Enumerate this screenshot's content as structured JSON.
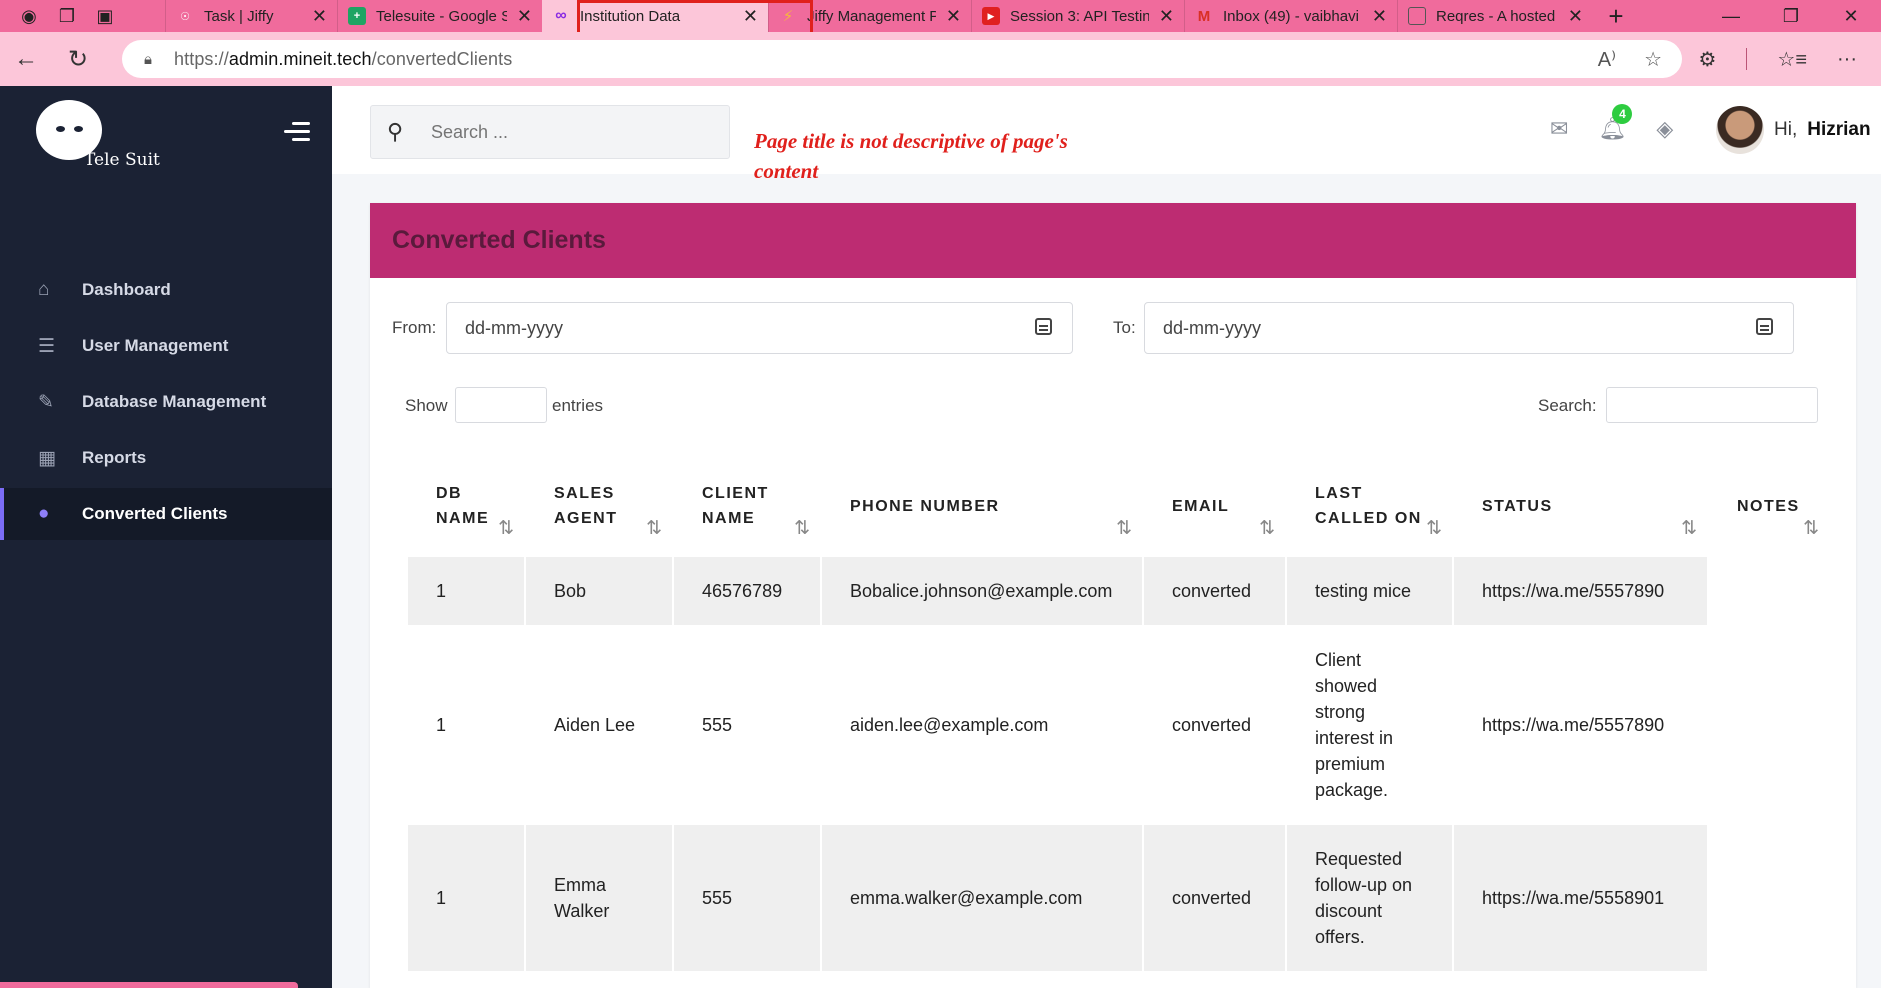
{
  "browser": {
    "tabs": [
      {
        "title": "Task | Jiffy",
        "favicon_color": "#f06b9c",
        "favicon": "finger-print-icon"
      },
      {
        "title": "Telesuite - Google Sh",
        "favicon_color": "#1fa463",
        "favicon": "sheets-icon"
      },
      {
        "title": "Institution Data",
        "favicon_color": "#8a2be2",
        "favicon": "infinity-icon",
        "active": true
      },
      {
        "title": "Jiffy Management Pa",
        "favicon_color": "#f6b83b",
        "favicon": "bolt-icon"
      },
      {
        "title": "Session 3: API Testin",
        "favicon_color": "#e02020",
        "favicon": "youtube-icon"
      },
      {
        "title": "Inbox (49) - vaibhavi",
        "favicon_color": "#d93025",
        "favicon": "gmail-icon"
      },
      {
        "title": "Reqres - A hosted RE",
        "favicon_color": "#555555",
        "favicon": "page-icon"
      }
    ],
    "url_prefix": "https://",
    "url_host": "admin.mineit.tech",
    "url_path": "/convertedClients"
  },
  "sidebar": {
    "brand": "Tele Suit",
    "items": [
      {
        "label": "Dashboard",
        "icon": "home-icon"
      },
      {
        "label": "User Management",
        "icon": "list-icon"
      },
      {
        "label": "Database Management",
        "icon": "edit-icon"
      },
      {
        "label": "Reports",
        "icon": "table-icon"
      },
      {
        "label": "Converted Clients",
        "icon": "map-pin-icon",
        "active": true
      }
    ]
  },
  "header": {
    "search_placeholder": "Search ...",
    "notification_count": "4",
    "greeting": "Hi,",
    "user_name": "Hizrian"
  },
  "annotation": {
    "text": "Page title is not descriptive of page's content",
    "color": "#e0201c"
  },
  "page": {
    "title": "Converted Clients",
    "from_label": "From:",
    "from_value": "dd-mm-yyyy",
    "to_label": "To:",
    "to_value": "dd-mm-yyyy",
    "show_label": "Show",
    "entries_label": "entries",
    "search_label": "Search:"
  },
  "table": {
    "headers": [
      "DB NAME",
      "SALES AGENT",
      "CLIENT NAME",
      "PHONE NUMBER",
      "EMAIL",
      "LAST CALLED ON",
      "STATUS",
      "NOTES"
    ],
    "rows": [
      [
        "1",
        "Bob",
        "46576789",
        "Bobalice.johnson@example.com",
        "converted",
        "testing mice",
        "https://wa.me/5557890"
      ],
      [
        "1",
        "Aiden Lee",
        "555",
        "aiden.lee@example.com",
        "converted",
        "Client showed strong interest in premium package.",
        "https://wa.me/5557890"
      ],
      [
        "1",
        "Emma Walker",
        "555",
        "emma.walker@example.com",
        "converted",
        "Requested follow-up on discount offers.",
        "https://wa.me/5558901"
      ]
    ]
  },
  "colors": {
    "tab_strip": "#f06b9c",
    "sidebar_bg": "#1b2234",
    "card_header": "#bd2c72",
    "accent": "#7b6cf6"
  }
}
